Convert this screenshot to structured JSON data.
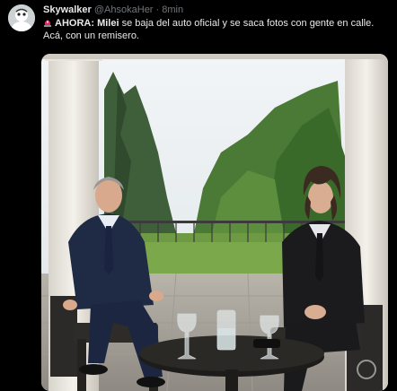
{
  "tweet": {
    "author_name": "Skywalker",
    "handle": "@AhsokaHer",
    "separator": "·",
    "time": "8min",
    "siren_icon": "police-siren-icon",
    "text_segments": [
      {
        "text": "AHORA: ",
        "bold": true
      },
      {
        "text": "Milei",
        "bold": true
      },
      {
        "text": " se baja del auto oficial y se saca fotos con gente en calle. Acá, con un remisero.",
        "bold": false
      }
    ],
    "media": {
      "kind": "photo",
      "scene": "two men in suits seated on a porch with a small table holding glasses"
    },
    "colors": {
      "background": "#000000",
      "text": "#e7e9ea",
      "muted": "#71767b"
    }
  }
}
